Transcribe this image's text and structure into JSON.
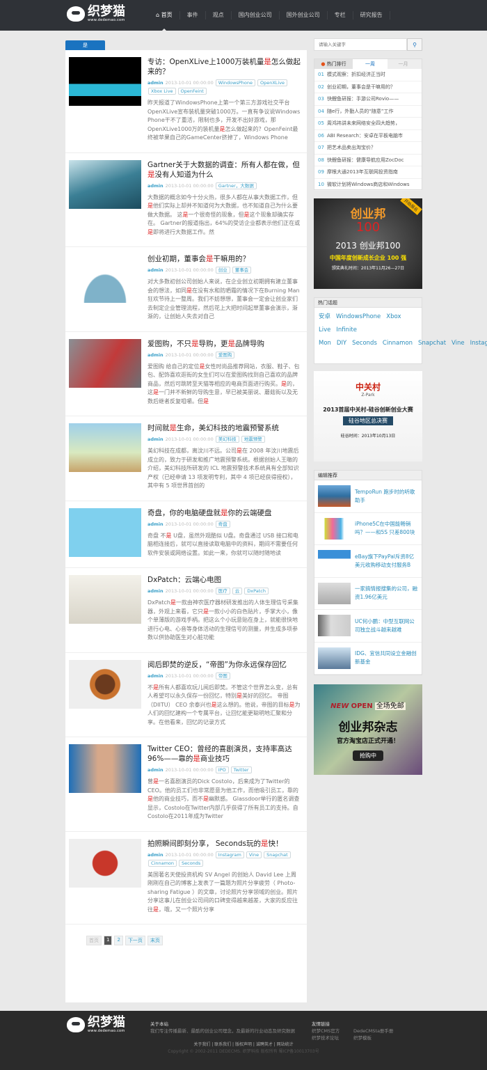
{
  "header": {
    "logo_text": "织梦猫",
    "logo_url": "www.dedemao.com",
    "nav": [
      "首页",
      "事件",
      "观点",
      "国内创业公司",
      "国外创业公司",
      "专栏",
      "研究报告"
    ]
  },
  "main": {
    "tab": "是",
    "highlight": "是",
    "articles": [
      {
        "title": "专访：OpenXLive上1000万装机量是怎么做起来的？",
        "author": "admin",
        "date": "2013-10-01 00:00:00",
        "tags": [
          "WindowsPhone",
          "OpenXLive",
          "Xbox Live",
          "OpenFeint"
        ],
        "summary": "昨天报道了WindowsPhone上第一个第三方游戏社交平台OpenXLive宣布装机量突破1000万。一直有争议说Windows Phone干不了重活，限制也多，开发不出好游戏，那OpenXLive1000万的装机量是怎么做起来的？OpenFeint最终被苹果自己的GameCenter挤掉了，Windows Phone",
        "thumb": "linear-gradient(#000 0,#000 55%,#2bb8d6 55%,#2bb8d6 80%,#000 80%)"
      },
      {
        "title": "Gartner关于大数据的调查：所有人都在做，但是没有人知道为什么",
        "author": "admin",
        "date": "2013-10-01 00:00:00",
        "tags": [
          "Gartner，大数据"
        ],
        "summary": "大数据的概念如今十分火热，很多人都在从事大数据工作，但是他们实际上却并不知道何为大数据，也不知道自己为什么要做大数据。 这是一个很奇怪的现象，但是这个现象却确实存在。 Gartner的报道指出，64%的受访企业都表示他们正在或是即将进行大数据工作。然",
        "thumb": "linear-gradient(160deg,#c9e3ea,#3b7f95 50%,#1c4c5e)"
      },
      {
        "title": "创业初期，董事会是干嘛用的？",
        "author": "admin",
        "date": "2013-10-01 00:00:00",
        "tags": [
          "创业",
          "董事会"
        ],
        "summary": "对大多数初创公司创始人来说，在企业创立初期拥有建立董事会的想法，如同是在没有水和防晒霜的情况下在Burning Man狂欢节待上一整周。我们不妨想想，董事会一定会让创业家们去制定企业管理流程，然后花上大把时间起草董事会演示，渐渐的，让创始人失去对自己",
        "thumb": "radial-gradient(ellipse at 50% 100%,#7fb2c9 40%,#fff 42%)"
      },
      {
        "title": "爱图购，不只是导购，更是品牌导购",
        "author": "admin",
        "date": "2013-10-01 00:00:00",
        "tags": [
          "爱图购"
        ],
        "summary": "爱图购 给自己的定位是女性时尚品推荐网站，衣服、鞋子、包包、配饰喜欢逛街的女生们可以在爱图购找到自己喜欢的品牌商品，然后可跳转至天猫等相应的电商页面进行购买。是的，这是一门并不新鲜的导购生意，早已被美丽说、蘑菇街以及无数后继者反复咀嚼。但是",
        "thumb": "linear-gradient(120deg,#8a8f94,#c23a3a 55%,#6b7075)"
      },
      {
        "title": "时间就是生命，美幻科技的地震预警系统",
        "author": "admin",
        "date": "2013-10-01 00:00:00",
        "tags": [
          "美幻科技",
          "地震预警"
        ],
        "summary": "美幻科技在成都，离汶川不远。公司是在 2008 年汶川地震后成立的，致力于研发和推广地震预警系统。根据创始人王暾的介绍，美幻科技所研发的 ICL 地震预警技术系统具有全部知识产权（已经申请 13 项发明专利，其中 4 项已经获得授权），其中有 5 项世界首创的",
        "thumb": "linear-gradient(#9fd0ea,#d9e9c0 60%,#c7a36a)"
      },
      {
        "title": "奇盘，你的电脑硬盘就是你的云端硬盘",
        "author": "admin",
        "date": "2013-10-01 00:00:00",
        "tags": [
          "奇盘"
        ],
        "summary": "奇盘 不是 U盘，虽然外观酷似 U盘。奇盘通过 USB 接口和电脑相连接后，就可以直接读取电脑中的资料，期间不需要任何软件安装或网络设置。如此一来，你就可以随时随地读",
        "thumb": "linear-gradient(#7fd0ee,#7fd0ee)"
      },
      {
        "title": "DxPatch：云端心电图",
        "author": "admin",
        "date": "2013-10-01 00:00:00",
        "tags": [
          "医疗",
          "云",
          "DxPatch"
        ],
        "summary": "DxPatch是一款由神农医疗器材研发推出的人体生理信号采集器，外观上来看，它只是一款小小的白色贴片，手掌大小，像个单薄版的游戏手柄。把这么个小玩意贴在身上，就能很快地进行心电、心音等身体活动的生理信号的测量，并生成多项参数以供协助医生对心脏功能",
        "thumb": "linear-gradient(#f3f1ea,#d8d4c8)"
      },
      {
        "title": "阅后即焚的逆反，“帝图”为你永远保存回忆",
        "author": "admin",
        "date": "2013-10-01 00:00:00",
        "tags": [
          "帝图"
        ],
        "summary": "不是所有人都喜欢玩儿阅后即焚。不管这个世界怎么变，总有人希望可以永久保存一份回忆，特别是美好的回忆。 帝图（DIITU） CEO 余泰兴也是这么想的。他说，帝图的目标是为人们的回忆建构一个专属平台，让回忆能更聪明地汇聚和分享。在他看来，回忆的记录方式",
        "thumb": "radial-gradient(circle,#6b3a1e 22%,#c9722e 24%,#c9722e 34%,#eee 36%)"
      },
      {
        "title": "Twitter CEO：曾经的喜剧演员，支持率高达96%——靠的是商业技巧",
        "author": "admin",
        "date": "2013-10-01 00:00:00",
        "tags": [
          "IPO",
          "Twitter"
        ],
        "summary": "曾是一名喜剧演员的Dick Costolo，后来成为了Twitter的CEO。他的员工们也非常愿意为他工作，而他吸引员工，靠的是他的商业技巧，而不是幽默感。 Glassdoor举行的匿名调查显示，Costolo在Twitter内部几乎获得了所有员工的支持。自Costolo在2011年成为Twitter",
        "thumb": "linear-gradient(90deg,#1e6fb8,#d6a88a 40%,#d6a88a 60%,#1e6fb8)"
      },
      {
        "title": "拍照瞬间即刻分享， Seconds玩的是快！",
        "author": "admin",
        "date": "2013-10-01 00:00:00",
        "tags": [
          "Instagram",
          "Vine",
          "Snapchat",
          "Cinnamon",
          "Seconds"
        ],
        "summary": "美国著名天使投资机构 SV Angel 的创始人 David Lee 上周刚刚在自己的博客上发表了一篇题为照片分享疲劳（ Photo-sharing Fatigue ）的文章，讨论照片分享领域的创业。照片分享这事儿在创业公司间的口碑变得越来越差，大家的反应往往是，哦，又一个照片分享",
        "thumb": "radial-gradient(circle,#c8372a 28%,#eee 30%)"
      }
    ],
    "pagination": [
      "首页",
      "1",
      "2",
      "下一页",
      "末页"
    ]
  },
  "sidebar": {
    "search_placeholder": "请输入关键字",
    "search_icon": "magnifier-icon",
    "rank": {
      "title": "热门排行",
      "tabs": [
        "一周",
        "一月"
      ],
      "items": [
        "模式观察：折扣经济正当时",
        "创业初期，董事会是干嘛用的？",
        "快鲤鱼研报：手游公司Rovio——",
        "随e行，外勤人员的“随意”工作",
        "周鸿祎讲未来网络安全四大趋势，",
        "ABI Research：安卓在平板电脑市",
        "把艺术品卖出淘宝价？",
        "快鲤鱼研报：健康导航应用ZocDoc",
        "摩根大通2013年互联网投资指南",
        "微软计划将Windows商店和Windows"
      ]
    },
    "ad1": {
      "badge": "开始报名",
      "brand": "创业邦",
      "num": "100",
      "line1": "2013 创业邦100",
      "line2": "中国年度创新成长企业 100 强",
      "line3": "颁奖典礼时间：2013年11月26—27日"
    },
    "topics": {
      "title": "热门话题",
      "items": [
        "安卓",
        "WindowsPhone",
        "Xbox Live",
        "Infinite Mon",
        "DIY",
        "Seconds",
        "Cinnamon",
        "Snapchat",
        "Vine",
        "Instagram"
      ]
    },
    "ad2": {
      "brand": "中关村",
      "brand_en": "Z-Park",
      "line1": "2013首届中关村-硅谷创新创业大赛",
      "line2": "硅谷地区总决赛",
      "line3": "硅谷时间：2013年10月13日"
    },
    "picks": {
      "title": "编辑推荐",
      "items": [
        {
          "text": "TempoRun 跑步时的听歌助手",
          "thumb": "linear-gradient(#6aa6d8,#2f6ea0 50%,#c45a2a)"
        },
        {
          "text": "iPhone5C在中国能畅销吗？——和5S 只差800块",
          "thumb": "linear-gradient(90deg,#fff 20%,#cde03a 20%,#f06a9a 45%,#4ab3e6 70%,#fff 80%)"
        },
        {
          "text": "eBay旗下PayPal斥资8亿美元收购移动支付服务B",
          "thumb": "linear-gradient(#3a8fd8 40%,#fff 40%)"
        },
        {
          "text": "一家搞情报搜集的公司，融资1.96亿美元",
          "thumb": "linear-gradient(#ddd,#aaa)"
        },
        {
          "text": "UC何小鹏：中型互联网公司独立战斗越来越难",
          "thumb": "linear-gradient(90deg,#666,#ddd 40%,#ccc)"
        },
        {
          "text": "IDG、宜信共同设立金融创新基金",
          "thumb": "linear-gradient(#cfe2f0,#5a7a9a)"
        }
      ]
    },
    "ad3": {
      "new": "NEW",
      "open": "OPEN",
      "free": "全场免邮",
      "title": "创业邦杂志",
      "sub": "官方淘宝店正式开通！",
      "btn": "抢购中"
    }
  },
  "footer": {
    "about_title": "关于本站",
    "about_text": "我们专注传播最新、最酷的创业公司理念，及最新的行业动态及研究数据",
    "links_title": "友情链接",
    "links": [
      "织梦CMS官方",
      "DedeCMSta册手册",
      "织梦技术论坛",
      "织梦模板"
    ],
    "bottom_links": "关于我们 | 联系我们 | 版权声明 | 诚聘英才 | 网站统计",
    "copyright": "Copyright © 2002-2011 DEDECMS. 织梦科技 版权所有 蜀ICP备10013703号"
  }
}
